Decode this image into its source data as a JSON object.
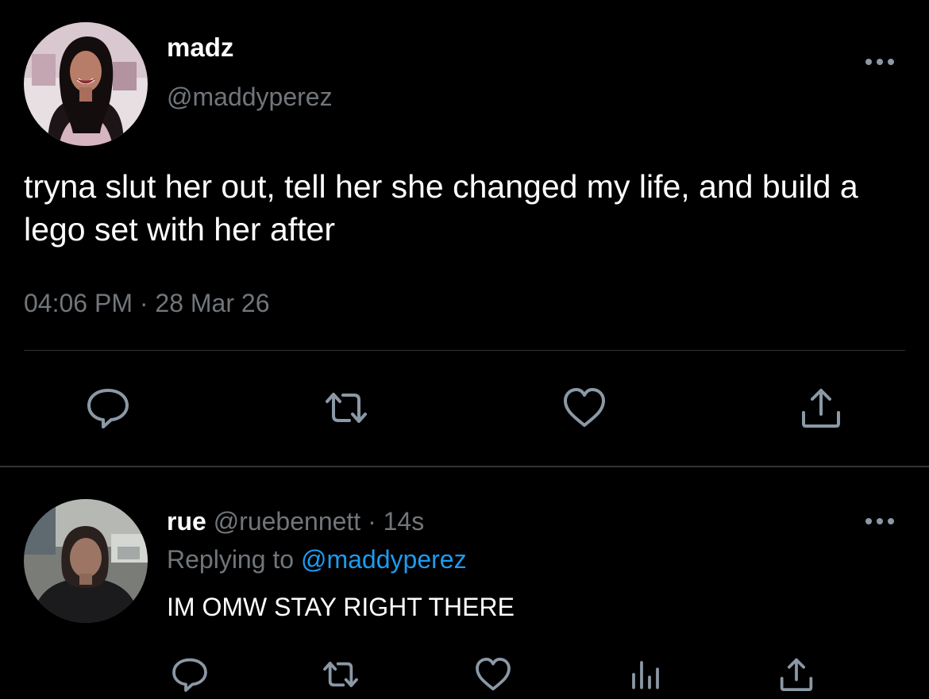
{
  "main_tweet": {
    "display_name": "madz",
    "handle": "@maddyperez",
    "text": "tryna slut her out, tell her she changed my life, and build a lego set with her after",
    "timestamp": "04:06 PM · 28 Mar 26",
    "avatar_icon": "profile-photo",
    "more_icon": "more-horizontal-icon",
    "actions": {
      "reply_icon": "reply-icon",
      "retweet_icon": "retweet-icon",
      "like_icon": "heart-icon",
      "share_icon": "share-icon"
    }
  },
  "reply_tweet": {
    "display_name": "rue",
    "handle_meta": "@ruebennett · 14s",
    "replying_prefix": "Replying to",
    "replying_mention": "@maddyperez",
    "text": "IM OMW STAY RIGHT THERE",
    "avatar_icon": "profile-photo",
    "more_icon": "more-horizontal-icon",
    "actions": {
      "reply_icon": "reply-icon",
      "retweet_icon": "retweet-icon",
      "like_icon": "heart-icon",
      "analytics_icon": "analytics-icon",
      "share_icon": "share-icon"
    }
  },
  "colors": {
    "background": "#000000",
    "primary_text": "#ffffff",
    "secondary_text": "#71767b",
    "link": "#1d9bf0",
    "divider": "#2f3336",
    "icon": "#8b98a5"
  }
}
